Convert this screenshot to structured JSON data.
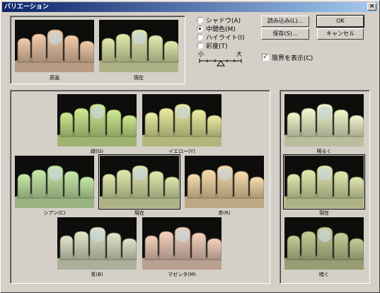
{
  "window": {
    "title": "バリエーション",
    "close_glyph": "×"
  },
  "compare": {
    "original": "原画",
    "current": "現在"
  },
  "modes": [
    {
      "label": "シャドウ(A)",
      "selected": false
    },
    {
      "label": "中間色(M)",
      "selected": true
    },
    {
      "label": "ハイライト(I)",
      "selected": false
    },
    {
      "label": "彩度(T)",
      "selected": false
    }
  ],
  "slider": {
    "min_label": "小",
    "max_label": "大"
  },
  "buttons": {
    "load": "読み込み(L)...",
    "save": "保存(S)...",
    "ok": "OK",
    "cancel": "キャンセル"
  },
  "clipping": {
    "label": "限界を表示(C)",
    "checked": true,
    "check_glyph": "✓"
  },
  "color_variations": {
    "green": "緑(G)",
    "yellow": "イエロー(Y)",
    "cyan": "シアン(C)",
    "current": "現在",
    "red": "赤(R)",
    "blue": "青(B)",
    "magenta": "マゼンタ(M)"
  },
  "brightness": {
    "lighter": "明るく",
    "current": "現在",
    "darker": "暗く"
  },
  "colors": {
    "title_start": "#0a246a",
    "title_end": "#a6caf0",
    "face": "#d4d0c8",
    "t_original": "#e6c2a4",
    "t_current": "#d8dfa6",
    "t_green": "#c4e08a",
    "t_yellow": "#e0e29a",
    "t_cyan": "#bfe0a2",
    "t_red": "#ecd2a4",
    "t_blue": "#d6dcc0",
    "t_magenta": "#e8c8b4",
    "t_lighter": "#e8ecc4",
    "t_darker": "#bcc490"
  }
}
